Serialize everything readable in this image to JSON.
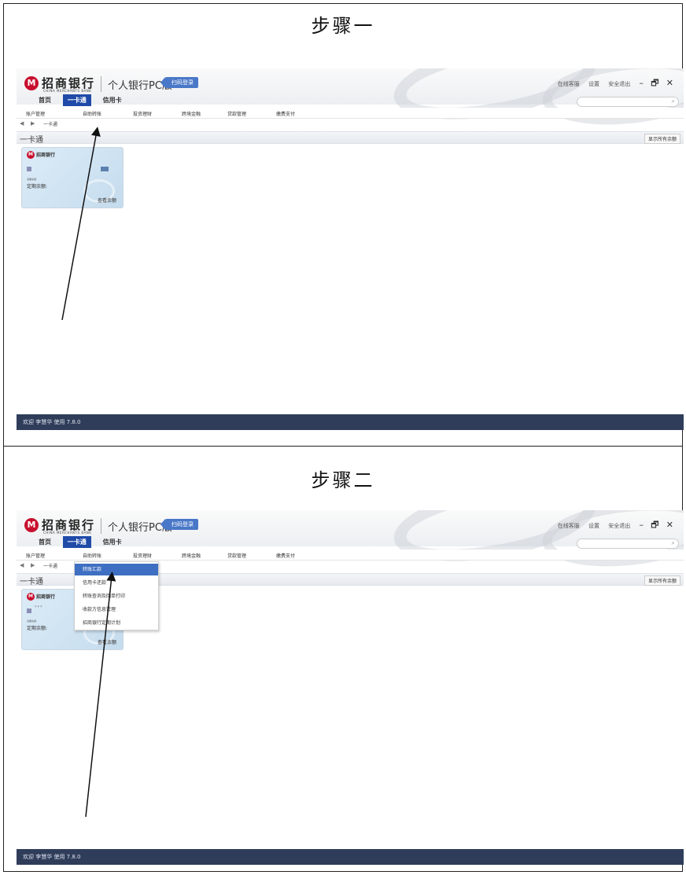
{
  "steps": [
    {
      "title": "步骤一"
    },
    {
      "title": "步骤二"
    }
  ],
  "app": {
    "logo_icon": "cmb-logo-icon",
    "logo_cn": "招商银行",
    "logo_en": "CHINA MERCHANTS BANK",
    "version_title": "个人银行PC版",
    "scan_login": "扫码登录",
    "top_links": {
      "service": "在线客服",
      "settings": "设置",
      "logout": "安全退出"
    },
    "window_controls": {
      "minimize": "–",
      "restore": "🗗",
      "close": "✕"
    },
    "main_nav": {
      "home": "首页",
      "onecard": "一卡通",
      "credit": "信用卡"
    },
    "search_icon": "⌕",
    "sub_nav": [
      "账户管理",
      "自助转账",
      "投资理财",
      "跨境金融",
      "贷款管理",
      "缴费支付"
    ],
    "breadcrumb": {
      "back": "◀",
      "forward": "▶",
      "current": "一卡通"
    },
    "section_title": "一卡通",
    "show_balance": "显示所有余额",
    "card": {
      "name": "招商银行",
      "stars": "***",
      "label_small": "活期余额:",
      "label_fixed": "定期余额:",
      "check": "查看余额"
    },
    "status_text": "欢迎 李慧华 使用 7.8.0",
    "dropdown": [
      "转账汇款",
      "信用卡还款",
      "转账查询及回单打印",
      "收款方信息管理",
      "招商银行定期计划"
    ]
  },
  "colors": {
    "brand_red": "#c8102e",
    "nav_active": "#1f4aa8",
    "status_bar": "#2f3d5a",
    "dropdown_active": "#3e6fc2"
  }
}
